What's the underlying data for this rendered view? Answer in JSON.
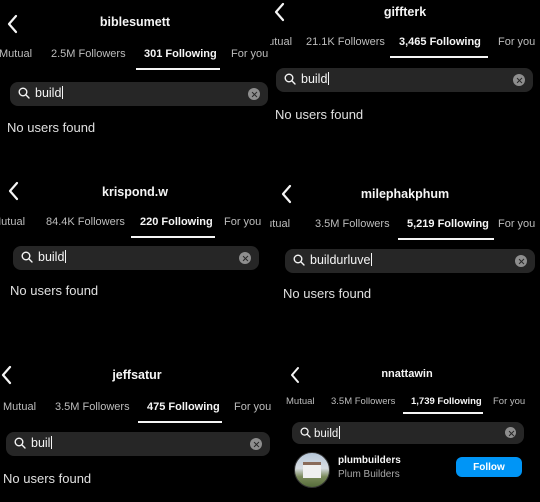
{
  "panels": [
    {
      "username": "biblesumett",
      "tabs": [
        "Mutual",
        "2.5M Followers",
        "301 Following",
        "For you"
      ],
      "search_value": "build",
      "empty_text": "No users found"
    },
    {
      "username": "giffterk",
      "tabs": [
        "Mutual",
        "21.1K Followers",
        "3,465 Following",
        "For you"
      ],
      "search_value": "build",
      "empty_text": "No users found"
    },
    {
      "username": "krispond.w",
      "tabs": [
        "Mutual",
        "84.4K Followers",
        "220 Following",
        "For you"
      ],
      "search_value": "build",
      "empty_text": "No users found"
    },
    {
      "username": "milephakphum",
      "tabs": [
        "Mutual",
        "3.5M Followers",
        "5,219 Following",
        "For you"
      ],
      "search_value": "buildurluve",
      "empty_text": "No users found"
    },
    {
      "username": "jeffsatur",
      "tabs": [
        "Mutual",
        "3.5M Followers",
        "475 Following",
        "For you"
      ],
      "search_value": "buil",
      "empty_text": "No users found"
    },
    {
      "username": "nnattawin",
      "tabs": [
        "Mutual",
        "3.5M Followers",
        "1,739 Following",
        "For you"
      ],
      "search_value": "build",
      "result": {
        "handle": "plumbuilders",
        "display_name": "Plum Builders",
        "follow_label": "Follow"
      }
    }
  ],
  "icons": {
    "back": "chevron-left-icon",
    "search": "search-icon",
    "clear": "clear-icon"
  },
  "colors": {
    "background": "#000000",
    "search_bg": "#262626",
    "follow_button": "#0095f6"
  }
}
